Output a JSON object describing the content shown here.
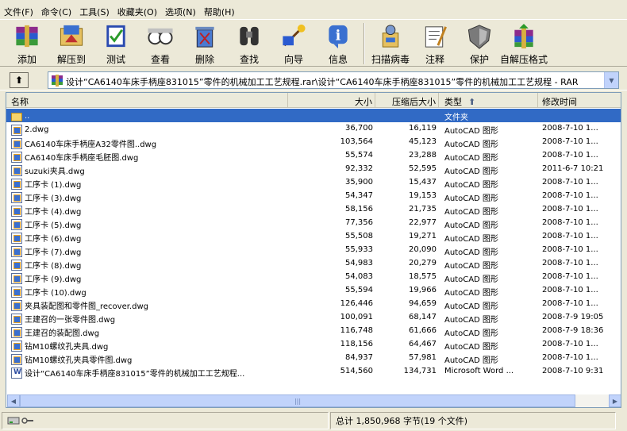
{
  "menu": [
    "文件(F)",
    "命令(C)",
    "工具(S)",
    "收藏夹(O)",
    "选项(N)",
    "帮助(H)"
  ],
  "toolbar": [
    {
      "label": "添加",
      "icon": "add-archive-icon"
    },
    {
      "label": "解压到",
      "icon": "extract-to-icon"
    },
    {
      "label": "测试",
      "icon": "test-icon"
    },
    {
      "label": "查看",
      "icon": "view-icon"
    },
    {
      "label": "删除",
      "icon": "delete-icon"
    },
    {
      "label": "查找",
      "icon": "find-icon"
    },
    {
      "label": "向导",
      "icon": "wizard-icon"
    },
    {
      "label": "信息",
      "icon": "info-icon"
    },
    {
      "label": "扫描病毒",
      "icon": "virus-scan-icon"
    },
    {
      "label": "注释",
      "icon": "comment-icon"
    },
    {
      "label": "保护",
      "icon": "protect-icon"
    },
    {
      "label": "自解压格式",
      "icon": "sfx-icon"
    }
  ],
  "address": "设计“CA6140车床手柄座831015”零件的机械加工工艺规程.rar\\设计“CA6140车床手柄座831015”零件的机械加工工艺规程 - RAR",
  "columns": {
    "name": "名称",
    "size": "大小",
    "packed": "压缩后大小",
    "type": "类型",
    "modified": "修改时间"
  },
  "files": [
    {
      "name": "..",
      "size": "",
      "packed": "",
      "type": "文件夹",
      "modified": "",
      "icon": "fold"
    },
    {
      "name": "2.dwg",
      "size": "36,700",
      "packed": "16,119",
      "type": "AutoCAD 图形",
      "modified": "2008-7-10 1...",
      "icon": "dwg"
    },
    {
      "name": "CA6140车床手柄座A32零件图..dwg",
      "size": "103,564",
      "packed": "45,123",
      "type": "AutoCAD 图形",
      "modified": "2008-7-10 1...",
      "icon": "dwg"
    },
    {
      "name": "CA6140车床手柄座毛胚图.dwg",
      "size": "55,574",
      "packed": "23,288",
      "type": "AutoCAD 图形",
      "modified": "2008-7-10 1...",
      "icon": "dwg"
    },
    {
      "name": "suzuki夹具.dwg",
      "size": "92,332",
      "packed": "52,595",
      "type": "AutoCAD 图形",
      "modified": "2011-6-7 10:21",
      "icon": "dwg"
    },
    {
      "name": "工序卡 (1).dwg",
      "size": "35,900",
      "packed": "15,437",
      "type": "AutoCAD 图形",
      "modified": "2008-7-10 1...",
      "icon": "dwg"
    },
    {
      "name": "工序卡 (3).dwg",
      "size": "54,347",
      "packed": "19,153",
      "type": "AutoCAD 图形",
      "modified": "2008-7-10 1...",
      "icon": "dwg"
    },
    {
      "name": "工序卡 (4).dwg",
      "size": "58,156",
      "packed": "21,735",
      "type": "AutoCAD 图形",
      "modified": "2008-7-10 1...",
      "icon": "dwg"
    },
    {
      "name": "工序卡 (5).dwg",
      "size": "77,356",
      "packed": "22,977",
      "type": "AutoCAD 图形",
      "modified": "2008-7-10 1...",
      "icon": "dwg"
    },
    {
      "name": "工序卡 (6).dwg",
      "size": "55,508",
      "packed": "19,271",
      "type": "AutoCAD 图形",
      "modified": "2008-7-10 1...",
      "icon": "dwg"
    },
    {
      "name": "工序卡 (7).dwg",
      "size": "55,933",
      "packed": "20,090",
      "type": "AutoCAD 图形",
      "modified": "2008-7-10 1...",
      "icon": "dwg"
    },
    {
      "name": "工序卡 (8).dwg",
      "size": "54,983",
      "packed": "20,279",
      "type": "AutoCAD 图形",
      "modified": "2008-7-10 1...",
      "icon": "dwg"
    },
    {
      "name": "工序卡 (9).dwg",
      "size": "54,083",
      "packed": "18,575",
      "type": "AutoCAD 图形",
      "modified": "2008-7-10 1...",
      "icon": "dwg"
    },
    {
      "name": "工序卡 (10).dwg",
      "size": "55,594",
      "packed": "19,966",
      "type": "AutoCAD 图形",
      "modified": "2008-7-10 1...",
      "icon": "dwg"
    },
    {
      "name": "夹具装配图和零件图_recover.dwg",
      "size": "126,446",
      "packed": "94,659",
      "type": "AutoCAD 图形",
      "modified": "2008-7-10 1...",
      "icon": "dwg"
    },
    {
      "name": "王建召的一张零件图.dwg",
      "size": "100,091",
      "packed": "68,147",
      "type": "AutoCAD 图形",
      "modified": "2008-7-9 19:05",
      "icon": "dwg"
    },
    {
      "name": "王建召的装配图.dwg",
      "size": "116,748",
      "packed": "61,666",
      "type": "AutoCAD 图形",
      "modified": "2008-7-9 18:36",
      "icon": "dwg"
    },
    {
      "name": "钻M10螺纹孔夹具.dwg",
      "size": "118,156",
      "packed": "64,467",
      "type": "AutoCAD 图形",
      "modified": "2008-7-10 1...",
      "icon": "dwg"
    },
    {
      "name": "钻M10螺纹孔夹具零件图.dwg",
      "size": "84,937",
      "packed": "57,981",
      "type": "AutoCAD 图形",
      "modified": "2008-7-10 1...",
      "icon": "dwg"
    },
    {
      "name": "设计“CA6140车床手柄座831015”零件的机械加工工艺规程...",
      "size": "514,560",
      "packed": "134,731",
      "type": "Microsoft Word ...",
      "modified": "2008-7-10 9:31",
      "icon": "doc"
    }
  ],
  "status": "总计 1,850,968 字节(19 个文件)"
}
